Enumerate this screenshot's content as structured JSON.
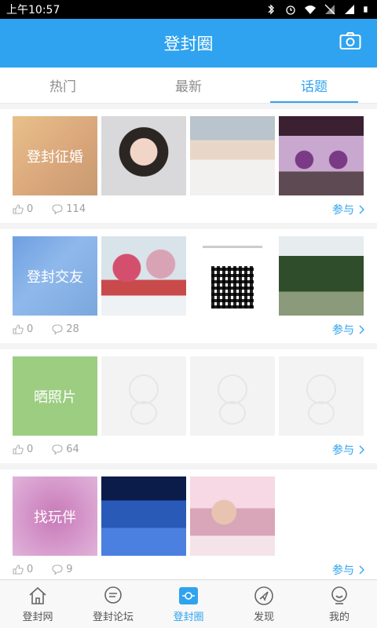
{
  "statusbar": {
    "time": "上午10:57"
  },
  "appbar": {
    "title": "登封圈"
  },
  "tabs": [
    {
      "label": "热门"
    },
    {
      "label": "最新"
    },
    {
      "label": "话题"
    }
  ],
  "topics": [
    {
      "label": "登封征婚",
      "likes": "0",
      "comments": "114",
      "join": "参与"
    },
    {
      "label": "登封交友",
      "likes": "0",
      "comments": "28",
      "join": "参与"
    },
    {
      "label": "晒照片",
      "likes": "0",
      "comments": "64",
      "join": "参与"
    },
    {
      "label": "找玩伴",
      "likes": "0",
      "comments": "9",
      "join": "参与"
    }
  ],
  "bottom_nav": [
    {
      "label": "登封网"
    },
    {
      "label": "登封论坛"
    },
    {
      "label": "登封圈"
    },
    {
      "label": "发现"
    },
    {
      "label": "我的"
    }
  ],
  "colors": {
    "accent": "#2fa3ef",
    "statusbar": "#000000"
  }
}
